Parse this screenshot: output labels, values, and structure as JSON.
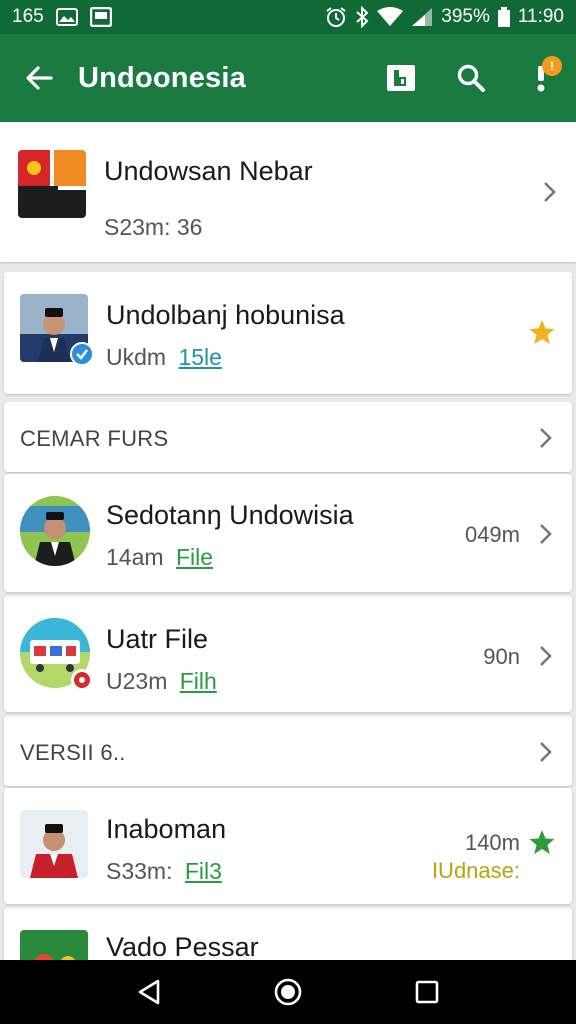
{
  "status_bar": {
    "time_left": "165",
    "battery": "395%",
    "clock": "11:90"
  },
  "app_bar": {
    "title": "Undoonesia",
    "notification_badge": "!"
  },
  "items": [
    {
      "title": "Undowsan Nebar",
      "subtitle": "S23m: 36"
    },
    {
      "title": "Undolbanj hobunisa",
      "subtitle_prefix": "Ukdm",
      "subtitle_link": "15le"
    },
    {
      "title": "Sedotanŋ Undowisia",
      "subtitle_prefix": "14am",
      "subtitle_link": "File",
      "meta": "049m"
    },
    {
      "title": "Uatr File",
      "subtitle_prefix": "U23m",
      "subtitle_link": "Filh",
      "meta": "90n"
    },
    {
      "title": "Inaboman",
      "subtitle_prefix": "S33m:",
      "subtitle_link": "Fil3",
      "meta": "140m",
      "meta2": "IUdnase:"
    },
    {
      "title": "Vado Pessar"
    }
  ],
  "sections": {
    "first": "CEMAR FURS",
    "second": "VERSII 6.."
  },
  "colors": {
    "status_bar": "#0f6a35",
    "app_bar": "#1a7a3f",
    "link_green": "#2b9a44",
    "link_teal": "#1f93a8",
    "star_gold": "#f0b11d",
    "star_green": "#2e9a3a",
    "meta_yellow": "#b5a512"
  }
}
